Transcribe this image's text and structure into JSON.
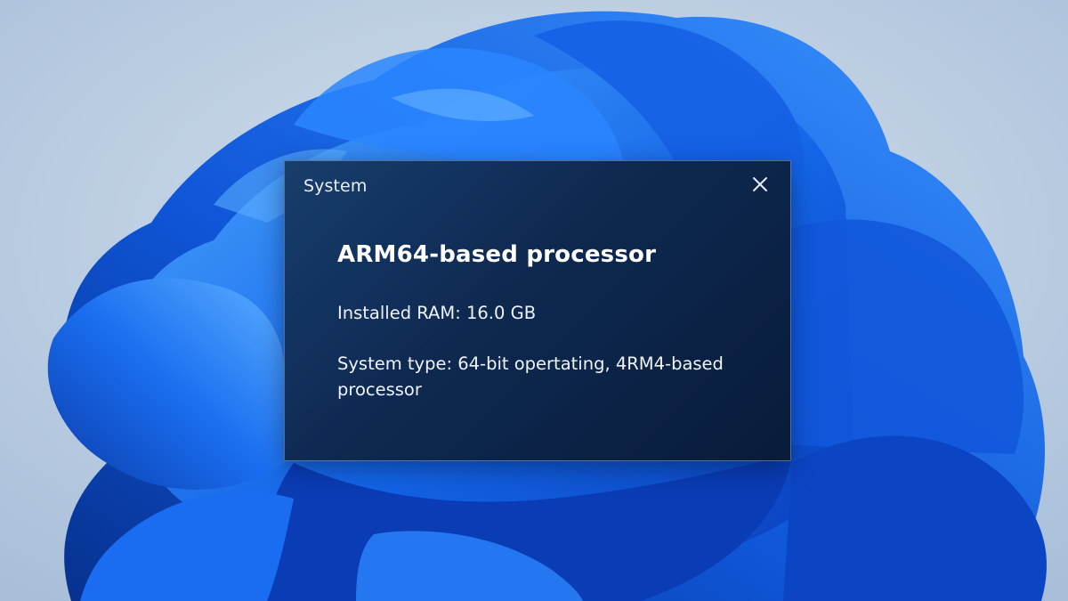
{
  "desktop": {
    "wallpaper": "windows-bloom-wallpaper",
    "colors": {
      "background": "#bfd0e3",
      "bloom_dark": "#0b3fbf",
      "bloom_mid": "#1565e6",
      "bloom_light": "#3a93ff"
    }
  },
  "dialog": {
    "title": "System",
    "close_icon": "close-icon",
    "heading": "ARM64-based processor",
    "installed_ram": "Installed RAM: 16.0 GB",
    "system_type": "System type: 64-bit opertating, 4RM4-based processor",
    "colors": {
      "background": "#0e264a",
      "border": "#8cafd7",
      "text": "#ffffff"
    }
  }
}
